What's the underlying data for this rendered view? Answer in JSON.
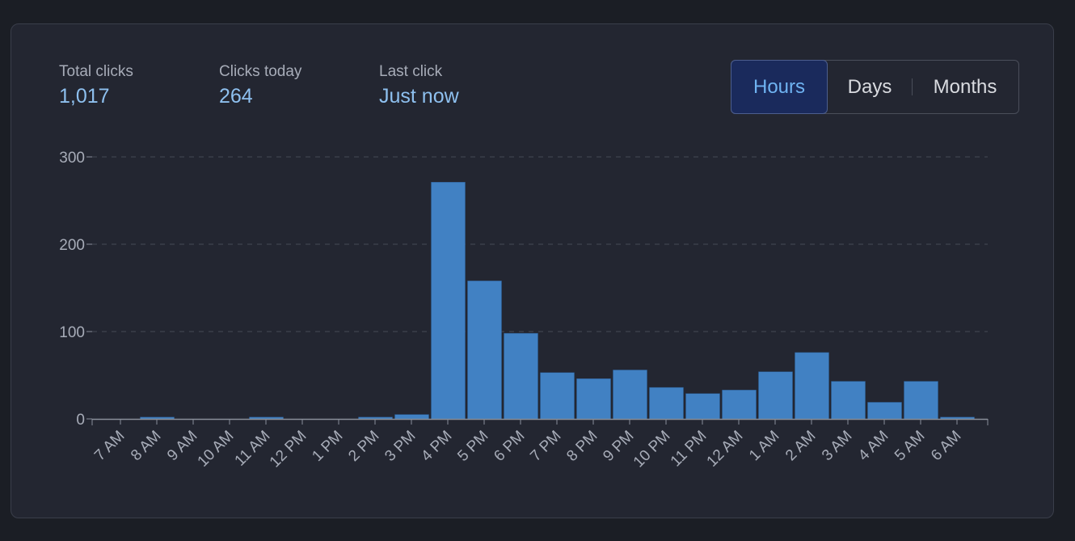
{
  "stats": [
    {
      "label": "Total clicks",
      "value": "1,017"
    },
    {
      "label": "Clicks today",
      "value": "264"
    },
    {
      "label": "Last click",
      "value": "Just now"
    }
  ],
  "toggle": {
    "options": [
      "Hours",
      "Days",
      "Months"
    ],
    "selected": "Hours"
  },
  "colors": {
    "bar": "#4181c3",
    "accent": "#8ec0ef",
    "active_bg": "#1a2a5c",
    "active_text": "#6fb3f2"
  },
  "chart_data": {
    "type": "bar",
    "categories": [
      "7 AM",
      "8 AM",
      "9 AM",
      "10 AM",
      "11 AM",
      "12 PM",
      "1 PM",
      "2 PM",
      "3 PM",
      "4 PM",
      "5 PM",
      "6 PM",
      "7 PM",
      "8 PM",
      "9 PM",
      "10 PM",
      "11 PM",
      "12 AM",
      "1 AM",
      "2 AM",
      "3 AM",
      "4 AM",
      "5 AM",
      "6 AM"
    ],
    "values": [
      0,
      2,
      0,
      0,
      2,
      0,
      0,
      2,
      5,
      271,
      158,
      98,
      53,
      46,
      56,
      36,
      29,
      33,
      54,
      76,
      43,
      19,
      43,
      2
    ],
    "ylim": [
      0,
      300
    ],
    "yticks": [
      0,
      100,
      200,
      300
    ],
    "grid": true,
    "xlabel": "",
    "ylabel": "",
    "title": ""
  }
}
